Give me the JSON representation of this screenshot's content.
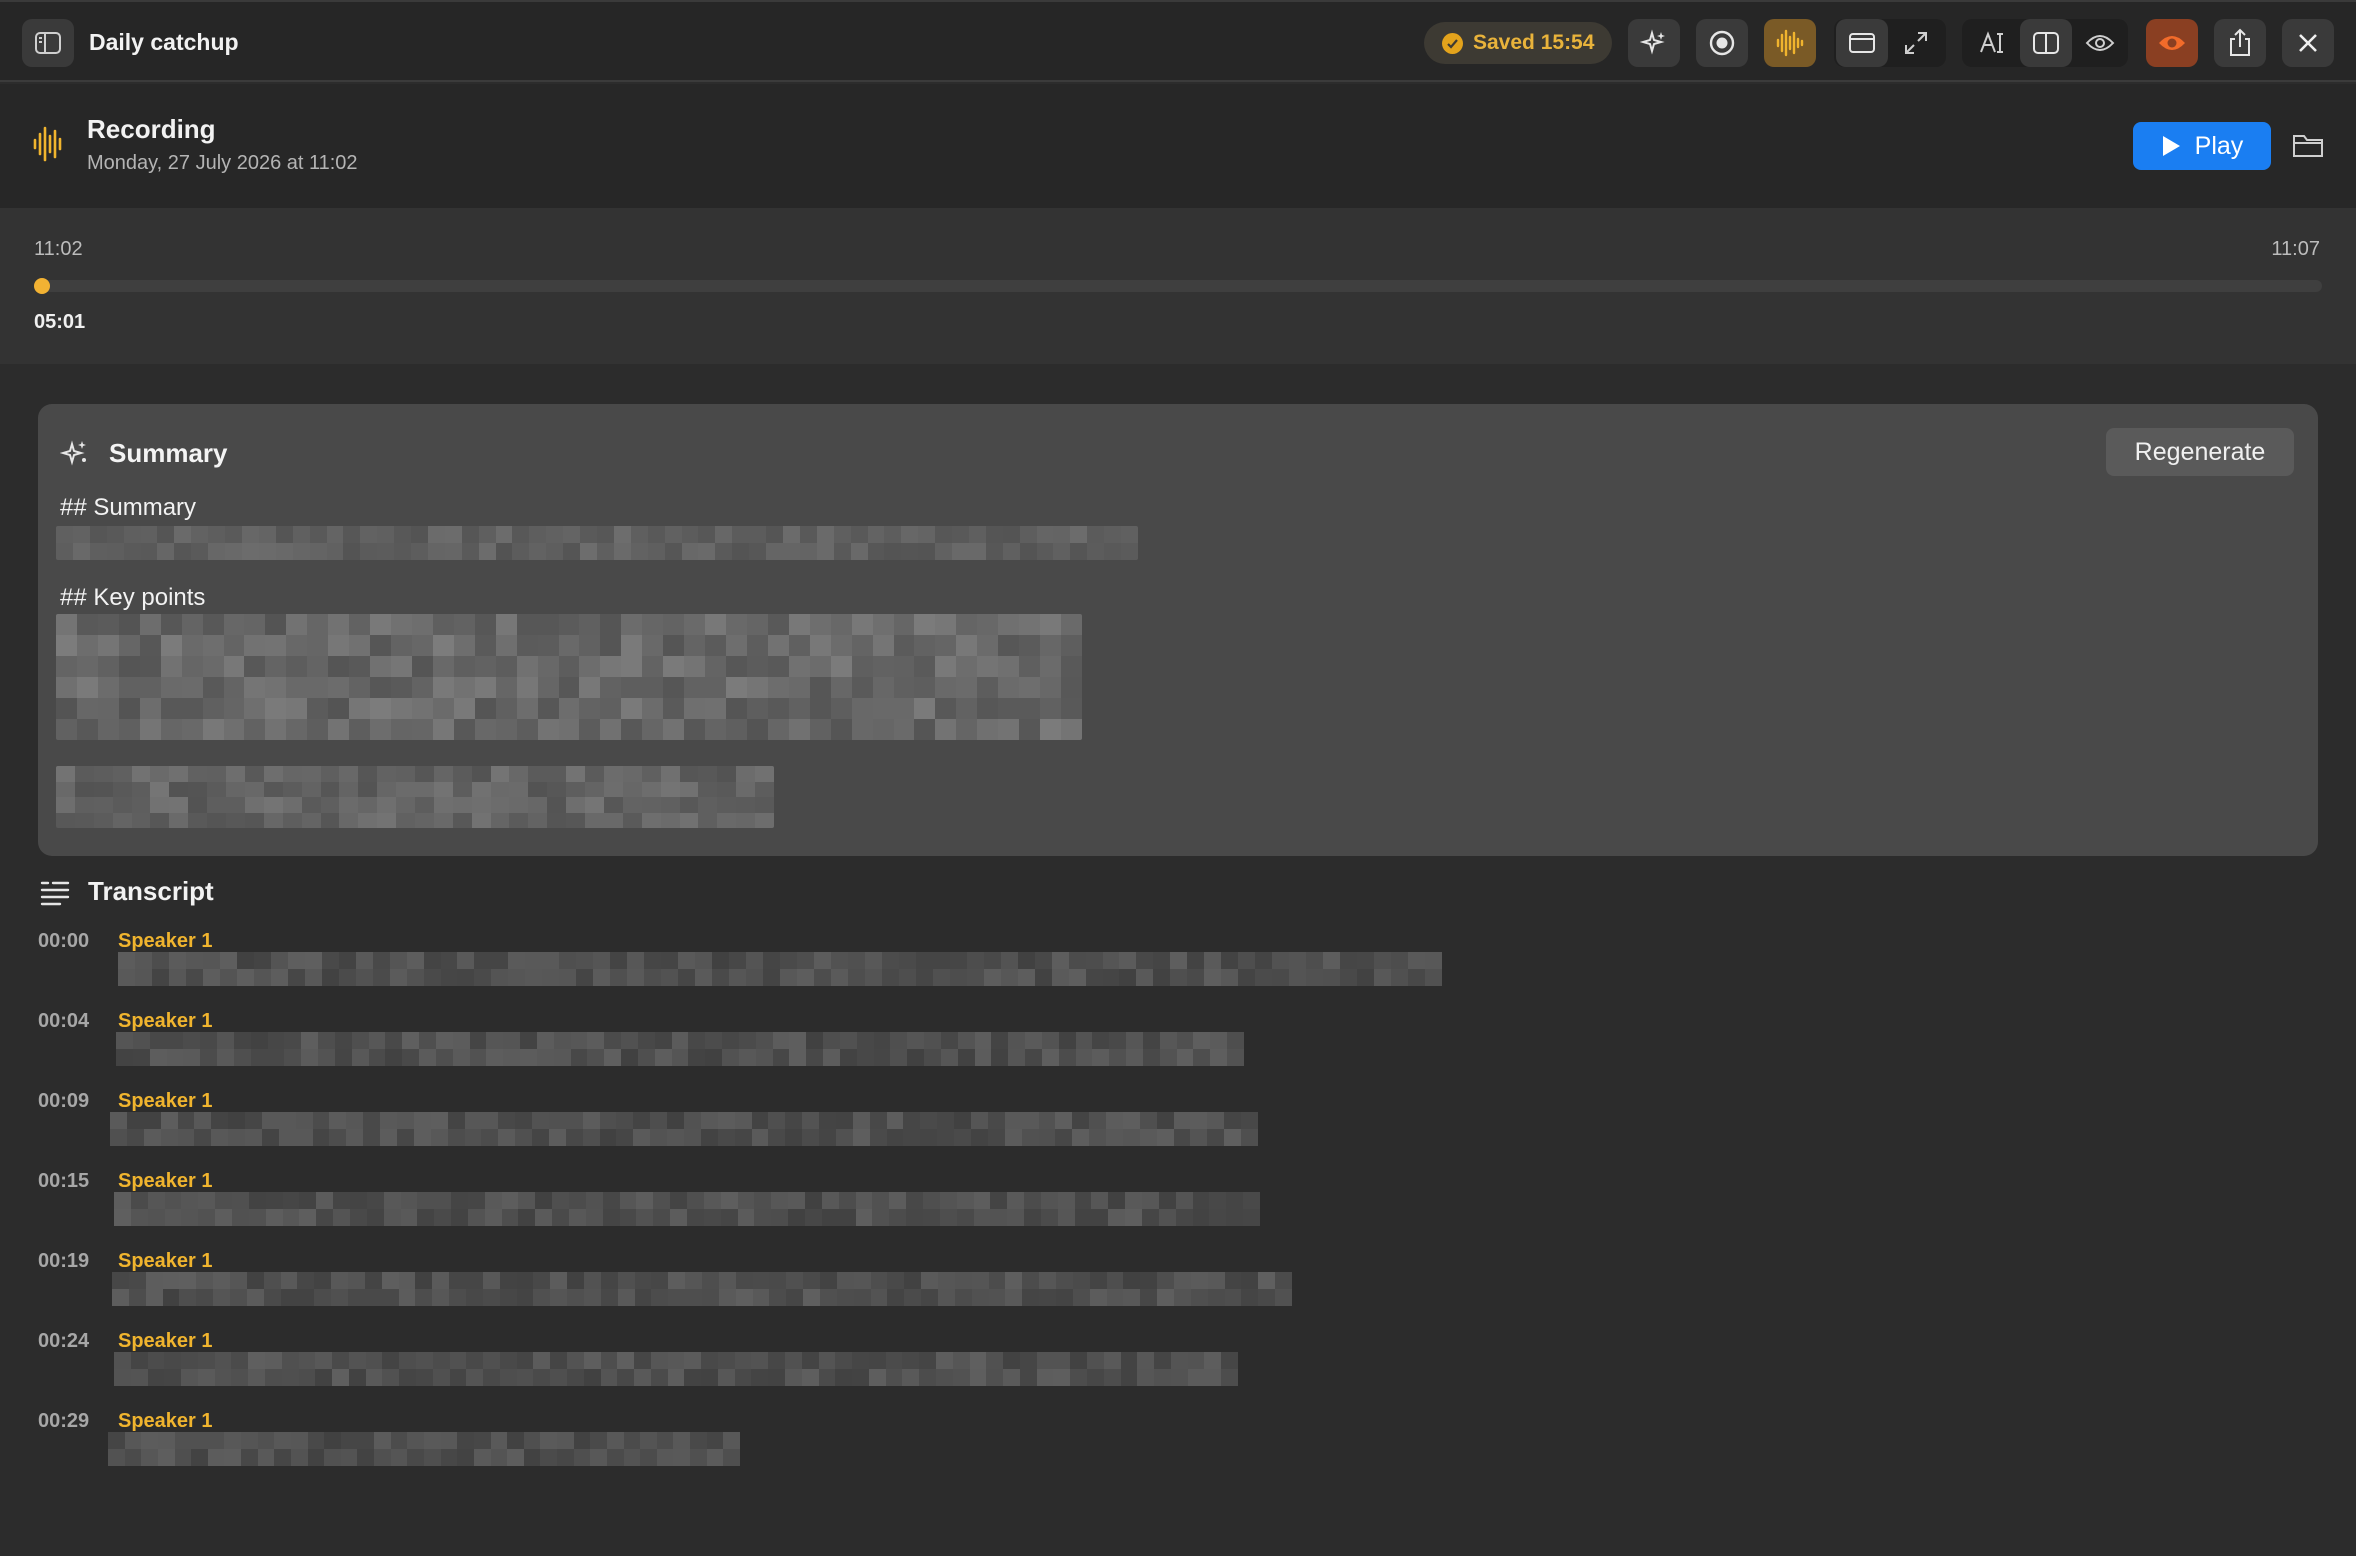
{
  "window": {
    "title": "Daily catchup",
    "saved_status": "Saved 15:54"
  },
  "colors": {
    "accent_orange": "#f0b42e",
    "play_blue": "#1a7ef2",
    "eye_active": "#f26b2a"
  },
  "toolbar": {
    "icons": [
      "sidebar-icon",
      "sparkle-icon",
      "record-icon",
      "waveform-icon",
      "window-icon",
      "expand-icon",
      "text-size-icon",
      "split-view-icon",
      "eye-icon",
      "eye-active-icon",
      "share-icon",
      "close-icon"
    ]
  },
  "recording": {
    "title": "Recording",
    "date": "Monday, 27 July 2026 at 11:02",
    "play_label": "Play"
  },
  "timeline": {
    "start": "11:02",
    "end": "11:07",
    "current": "05:01",
    "progress": 0.0
  },
  "summary": {
    "title": "Summary",
    "regenerate_label": "Regenerate",
    "heading_1": "## Summary",
    "heading_2": "## Key points"
  },
  "transcript": {
    "title": "Transcript",
    "entries": [
      {
        "time": "00:00",
        "speaker": "Speaker 1"
      },
      {
        "time": "00:04",
        "speaker": "Speaker 1"
      },
      {
        "time": "00:09",
        "speaker": "Speaker 1"
      },
      {
        "time": "00:15",
        "speaker": "Speaker 1"
      },
      {
        "time": "00:19",
        "speaker": "Speaker 1"
      },
      {
        "time": "00:24",
        "speaker": "Speaker 1"
      },
      {
        "time": "00:29",
        "speaker": "Speaker 1"
      }
    ]
  }
}
